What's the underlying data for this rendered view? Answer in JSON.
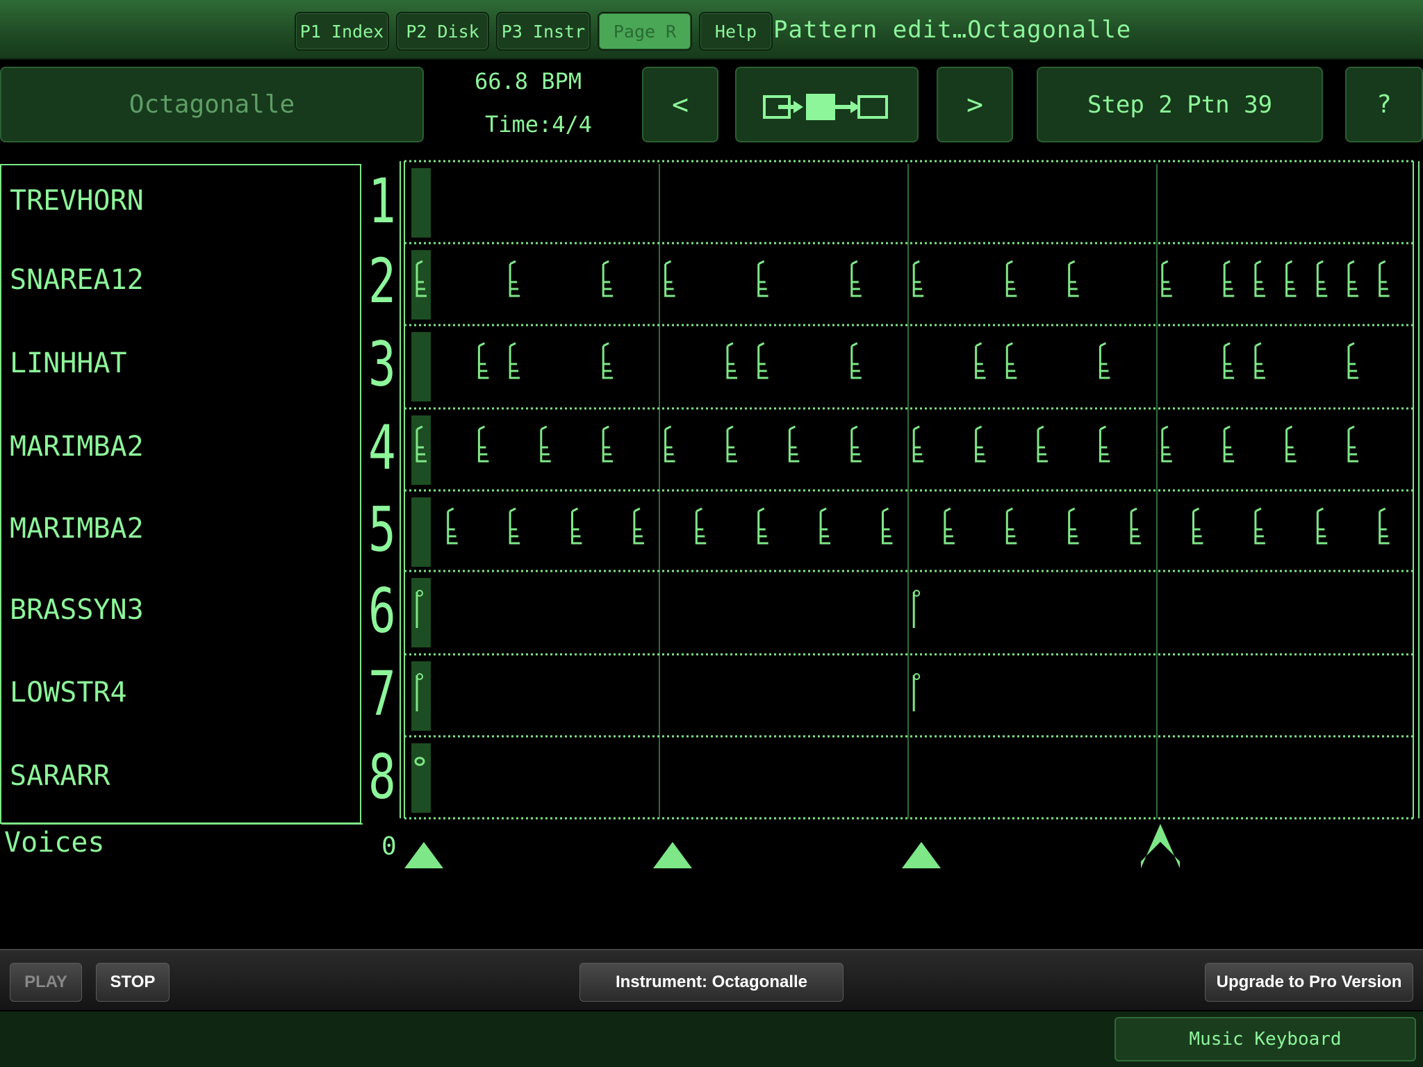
{
  "nav": {
    "tabs": [
      "P1 Index",
      "P2 Disk",
      "P3 Instr",
      "Page R",
      "Help"
    ],
    "active_tab": "Page R",
    "title": "Pattern edit…Octagonalle"
  },
  "header": {
    "song_name": "Octagonalle",
    "bpm": "66.8 BPM",
    "time_signature": "Time:4/4",
    "prev_label": "<",
    "next_label": ">",
    "step_label": "Step 2 Ptn 39",
    "help_label": "?"
  },
  "tracks": [
    {
      "number": "1",
      "instrument": "TREVHORN"
    },
    {
      "number": "2",
      "instrument": "SNAREA12"
    },
    {
      "number": "3",
      "instrument": "LINHHAT"
    },
    {
      "number": "4",
      "instrument": "MARIMBA2"
    },
    {
      "number": "5",
      "instrument": "MARIMBA2"
    },
    {
      "number": "6",
      "instrument": "BRASSYN3"
    },
    {
      "number": "7",
      "instrument": "LOWSTR4"
    },
    {
      "number": "8",
      "instrument": "SARARR"
    }
  ],
  "notes": {
    "track2_steps": [
      0,
      3,
      6,
      8,
      11,
      14,
      16,
      19,
      21,
      24,
      26,
      27,
      28,
      29,
      30,
      31
    ],
    "track3_steps": [
      2,
      3,
      6,
      10,
      11,
      14,
      18,
      19,
      22,
      26,
      27,
      30
    ],
    "track4_steps": [
      0,
      2,
      4,
      6,
      8,
      10,
      12,
      14,
      16,
      18,
      20,
      22,
      24,
      26,
      28,
      30
    ],
    "track5_steps": [
      1,
      3,
      5,
      7,
      9,
      11,
      13,
      15,
      17,
      19,
      21,
      23,
      25,
      27,
      29,
      31
    ],
    "track6_steps": [
      0,
      16
    ],
    "track7_steps": [
      0,
      16
    ],
    "track8_steps": [
      0
    ]
  },
  "voices_label": "Voices",
  "position_start": "0",
  "bottom": {
    "play_label": "PLAY",
    "stop_label": "STOP",
    "instrument_label": "Instrument: Octagonalle",
    "upgrade_label": "Upgrade to Pro Version",
    "keyboard_label": "Music Keyboard"
  },
  "colors": {
    "accent": "#7ee787",
    "background": "#000000",
    "panel": "#163a1b"
  }
}
